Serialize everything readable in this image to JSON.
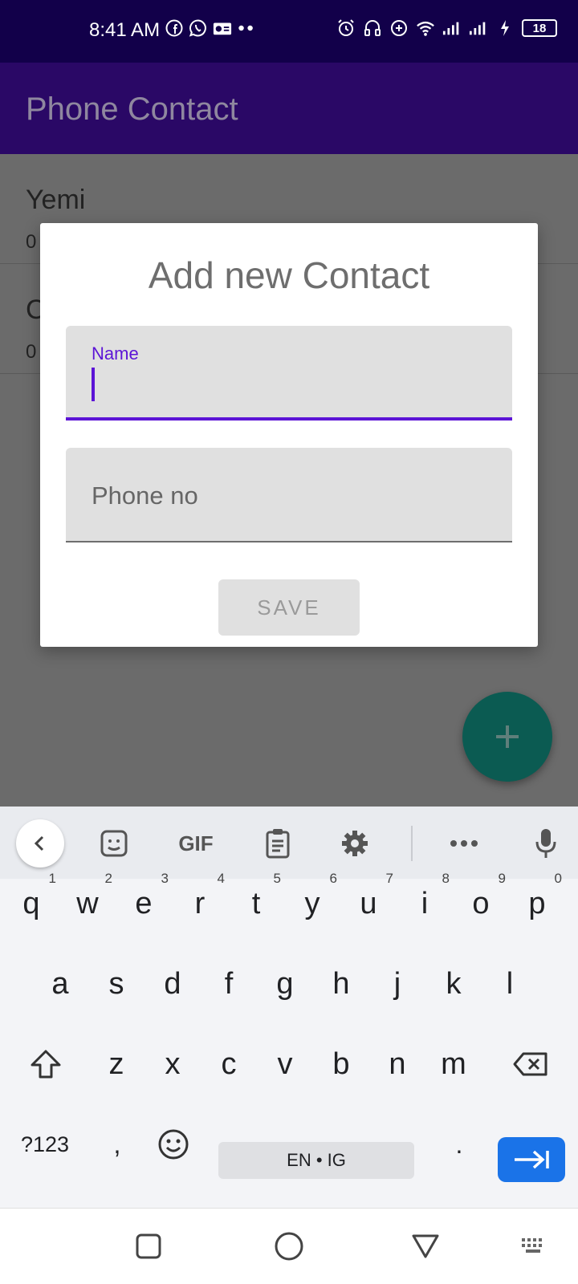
{
  "status_bar": {
    "time": "8:41 AM",
    "battery": "18",
    "left_icons": [
      "facebook-icon",
      "whatsapp-icon",
      "radio-icon",
      "more-dots-icon"
    ],
    "right_icons": [
      "alarm-icon",
      "headset-icon",
      "data-saver-icon",
      "wifi-icon",
      "signal-icon",
      "signal-icon",
      "charging-icon"
    ]
  },
  "app_bar": {
    "title": "Phone Contact"
  },
  "contacts": [
    {
      "name": "Yemi",
      "phone": "0"
    },
    {
      "name": "C",
      "phone": "0"
    }
  ],
  "dialog": {
    "title": "Add new Contact",
    "name_field": {
      "label": "Name",
      "value": ""
    },
    "phone_field": {
      "placeholder": "Phone no",
      "value": ""
    },
    "save_label": "SAVE"
  },
  "fab": {
    "icon": "plus-icon"
  },
  "keyboard": {
    "toolbar": [
      "back-arrow-icon",
      "sticker-icon",
      "GIF",
      "clipboard-icon",
      "settings-gear-icon",
      "more-icon",
      "microphone-icon"
    ],
    "gif_label": "GIF",
    "row1": [
      {
        "k": "q",
        "h": "1"
      },
      {
        "k": "w",
        "h": "2"
      },
      {
        "k": "e",
        "h": "3"
      },
      {
        "k": "r",
        "h": "4"
      },
      {
        "k": "t",
        "h": "5"
      },
      {
        "k": "y",
        "h": "6"
      },
      {
        "k": "u",
        "h": "7"
      },
      {
        "k": "i",
        "h": "8"
      },
      {
        "k": "o",
        "h": "9"
      },
      {
        "k": "p",
        "h": "0"
      }
    ],
    "row2": [
      "a",
      "s",
      "d",
      "f",
      "g",
      "h",
      "j",
      "k",
      "l"
    ],
    "row3": [
      "z",
      "x",
      "c",
      "v",
      "b",
      "n",
      "m"
    ],
    "symbols_label": "?123",
    "comma_label": ",",
    "period_label": ".",
    "space_label": "EN • IG"
  },
  "nav_bar": [
    "recent-apps-icon",
    "home-icon",
    "back-icon",
    "keyboard-switch-icon"
  ]
}
